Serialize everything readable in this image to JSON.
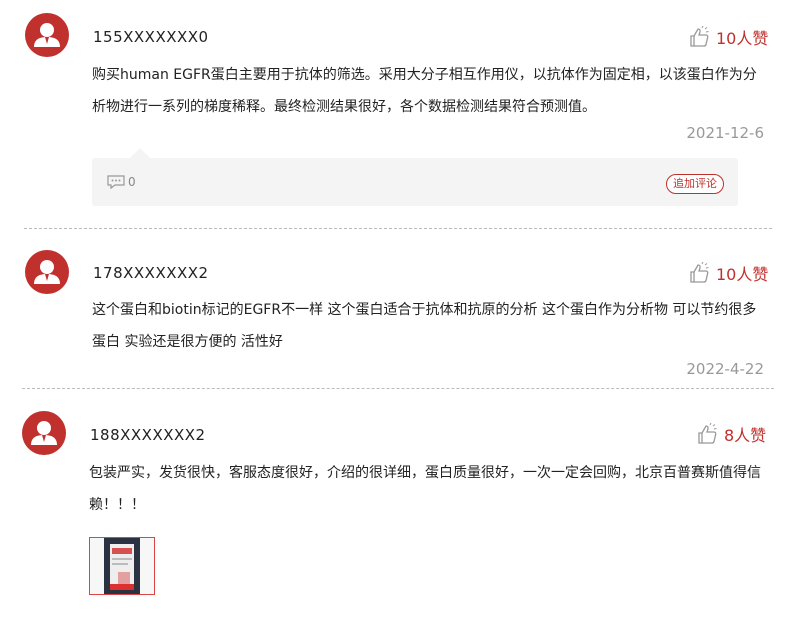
{
  "reviews": [
    {
      "username": "155XXXXXXX0",
      "likes_label": "10人赞",
      "content": "购买human EGFR蛋白主要用于抗体的筛选。采用大分子相互作用仪，以抗体作为固定相，以该蛋白作为分析物进行一系列的梯度稀释。最终检测结果很好，各个数据检测结果符合预测值。",
      "date": "2021-12-6",
      "comment_count": "0",
      "add_comment_label": "追加评论"
    },
    {
      "username": "178XXXXXXX2",
      "likes_label": "10人赞",
      "content": "这个蛋白和biotin标记的EGFR不一样 这个蛋白适合于抗体和抗原的分析 这个蛋白作为分析物 可以节约很多蛋白 实验还是很方便的 活性好",
      "date": "2022-4-22"
    },
    {
      "username": "188XXXXXXX2",
      "likes_label": "8人赞",
      "content": "包装严实，发货很快，客服态度很好，介绍的很详细，蛋白质量很好，一次一定会回购，北京百普赛斯值得信赖！！！"
    }
  ],
  "icons": {
    "avatar": "user-avatar-icon",
    "like": "thumbs-up-icon",
    "comment": "comment-bubble-icon"
  },
  "colors": {
    "accent": "#c0302c",
    "muted": "#999999",
    "reply_bg": "#f4f4f4"
  }
}
